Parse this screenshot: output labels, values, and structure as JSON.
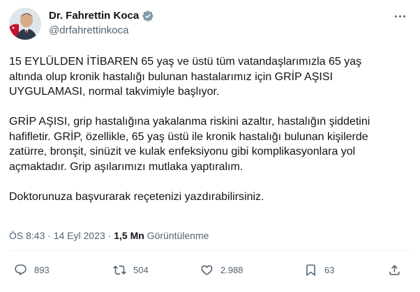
{
  "author": {
    "name": "Dr. Fahrettin Koca",
    "handle": "@drfahrettinkoca",
    "verified": true
  },
  "tweet": {
    "paragraphs": [
      "15 EYLÜLDEN İTİBAREN 65 yaş ve üstü tüm vatandaşlarımızla 65 yaş\naltında olup kronik hastalığı bulunan hastalarımız için GRİP AŞISI\nUYGULAMASI, normal takvimiyle başlıyor.",
      "GRİP AŞISI, grip hastalığına yakalanma riskini azaltır, hastalığın şiddetini\nhafifletir. GRİP, özellikle, 65 yaş üstü ile kronik hastalığı bulunan kişilerde\nzatürre, bronşit, sinüzit ve kulak enfeksiyonu gibi komplikasyonlara yol\naçmaktadır. Grip aşılarımızı mutlaka yaptıralım.",
      "Doktorunuza başvurarak reçetenizi yazdırabilirsiniz."
    ]
  },
  "meta": {
    "time": "ÖS 8:43",
    "sep1": "·",
    "date": "14 Eyl 2023",
    "sep2": "·",
    "views": "1,5 Mn",
    "views_label": "Görüntülenme"
  },
  "actions": {
    "replies": "893",
    "retweets": "504",
    "likes": "2.988",
    "bookmarks": "63"
  },
  "colors": {
    "text": "#0f1419",
    "secondary": "#536471",
    "verified": "#829aab",
    "divider": "#eff3f4"
  },
  "icons": [
    "more-icon",
    "verified-badge-icon",
    "reply-icon",
    "retweet-icon",
    "like-icon",
    "bookmark-icon",
    "share-icon"
  ]
}
